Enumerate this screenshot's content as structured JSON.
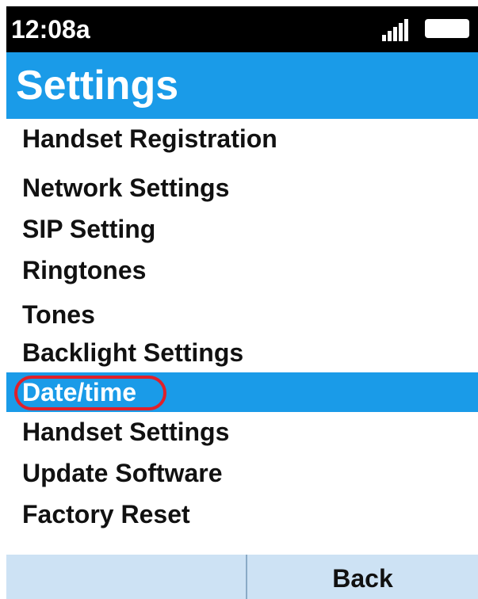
{
  "status_bar": {
    "time": "12:08a",
    "signal_icon": "signal-bars-icon",
    "battery_icon": "battery-icon"
  },
  "header": {
    "title": "Settings"
  },
  "menu": {
    "selected_index": 6,
    "items": [
      {
        "label": "Handset Registration"
      },
      {
        "label": "Network Settings"
      },
      {
        "label": "SIP Setting"
      },
      {
        "label": "Ringtones"
      },
      {
        "label": "Tones"
      },
      {
        "label": "Backlight Settings"
      },
      {
        "label": "Date/time"
      },
      {
        "label": "Handset Settings"
      },
      {
        "label": "Update Software"
      },
      {
        "label": "Factory Reset"
      }
    ]
  },
  "softkeys": {
    "left_label": "",
    "right_label": "Back"
  },
  "colors": {
    "accent": "#1a9be8",
    "highlight_ring": "#e0202a",
    "softkey_bg": "#cde2f4",
    "status_bar_bg": "#000000"
  }
}
